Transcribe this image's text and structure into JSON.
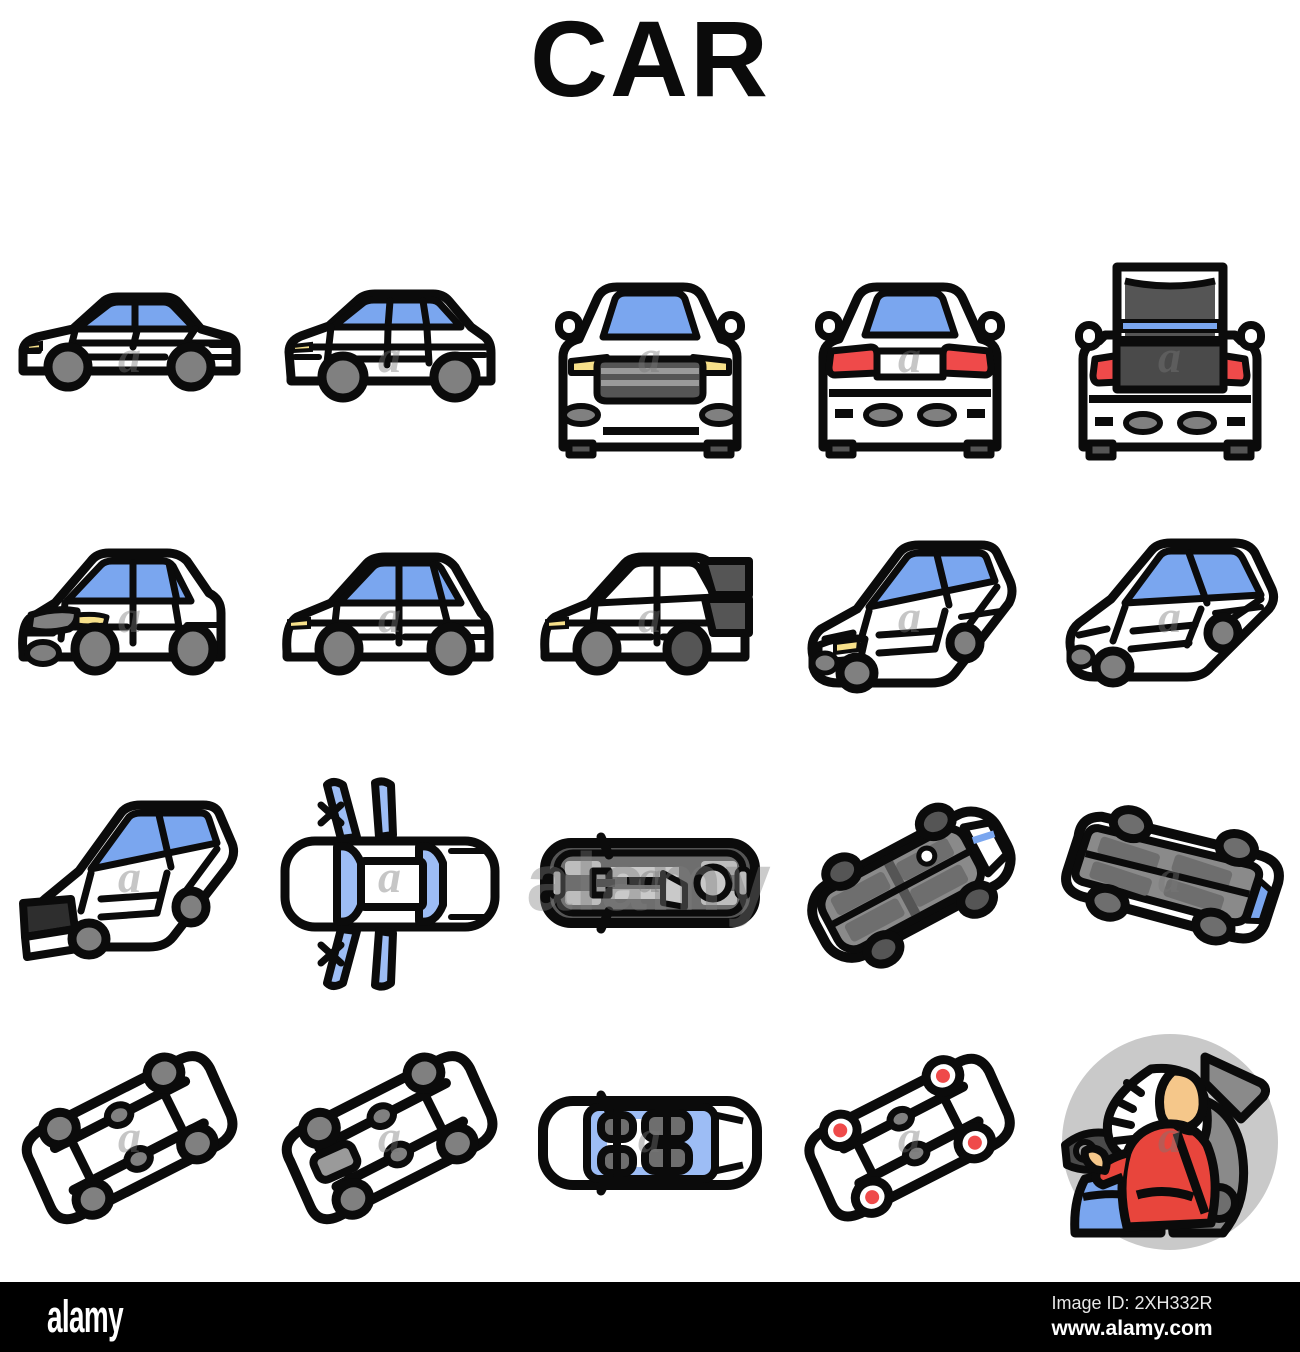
{
  "sheet": {
    "title": "CAR",
    "columns": 5,
    "rows": 4,
    "background_color": "#ffffff",
    "palette": {
      "outline": "#0b0b0b",
      "glass_blue": "#7aa6ef",
      "glass_blue_light": "#9dbdf5",
      "body_white": "#ffffff",
      "wheel_gray": "#808080",
      "dark_gray": "#555555",
      "mid_gray": "#9a9a9a",
      "light_gray": "#c9c9c9",
      "headlight_yellow": "#f7e08a",
      "taillight_red": "#ef4a4a",
      "skin": "#f5c78a",
      "shirt_red": "#e8453c",
      "seat_blue": "#7aa6ef"
    }
  },
  "icons": [
    {
      "row": 1,
      "col": 1,
      "name": "sedan-side-view",
      "label": "Sedan Side View"
    },
    {
      "row": 1,
      "col": 2,
      "name": "sedan-side-angle-view",
      "label": "Sedan Side Angle View"
    },
    {
      "row": 1,
      "col": 3,
      "name": "car-front-view",
      "label": "Car Front View"
    },
    {
      "row": 1,
      "col": 4,
      "name": "car-rear-view",
      "label": "Car Rear View"
    },
    {
      "row": 1,
      "col": 5,
      "name": "car-open-trunk",
      "label": "Car Open Trunk"
    },
    {
      "row": 2,
      "col": 1,
      "name": "car-three-quarter-front",
      "label": "Car Three Quarter Front"
    },
    {
      "row": 2,
      "col": 2,
      "name": "hatchback-side-view",
      "label": "Hatchback Side View"
    },
    {
      "row": 2,
      "col": 3,
      "name": "car-open-hatch-rear",
      "label": "Car Open Hatch Rear"
    },
    {
      "row": 2,
      "col": 4,
      "name": "car-isometric-front",
      "label": "Car Isometric Front"
    },
    {
      "row": 2,
      "col": 5,
      "name": "car-isometric-rear",
      "label": "Car Isometric Rear"
    },
    {
      "row": 3,
      "col": 1,
      "name": "car-isometric-open-hood",
      "label": "Car Isometric Open Hood"
    },
    {
      "row": 3,
      "col": 2,
      "name": "car-top-doors-open",
      "label": "Car Top View Doors Open"
    },
    {
      "row": 3,
      "col": 3,
      "name": "car-undercarriage-top",
      "label": "Car Undercarriage View"
    },
    {
      "row": 3,
      "col": 4,
      "name": "car-overturned-roof",
      "label": "Car Overturned On Roof"
    },
    {
      "row": 3,
      "col": 5,
      "name": "car-overturned-side",
      "label": "Car Overturned Side"
    },
    {
      "row": 4,
      "col": 1,
      "name": "car-chassis-frame",
      "label": "Car Chassis Frame"
    },
    {
      "row": 4,
      "col": 2,
      "name": "car-chassis-drivetrain",
      "label": "Car Chassis Drivetrain"
    },
    {
      "row": 4,
      "col": 3,
      "name": "car-interior-seats-top",
      "label": "Car Interior Seats Top"
    },
    {
      "row": 4,
      "col": 4,
      "name": "car-chassis-brakes",
      "label": "Car Chassis Brakes"
    },
    {
      "row": 4,
      "col": 5,
      "name": "airbag-deployment",
      "label": "Airbag Deployment"
    }
  ],
  "watermark": {
    "letter": "a",
    "center_text": "alamy"
  },
  "footer": {
    "logo": "alamy",
    "image_id": "Image ID: 2XH332R",
    "url": "www.alamy.com"
  }
}
